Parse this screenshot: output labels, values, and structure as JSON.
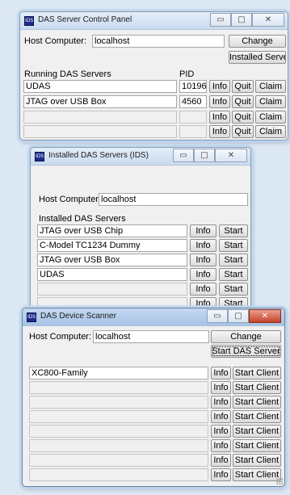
{
  "control_panel": {
    "title": "DAS Server Control Panel",
    "host_label": "Host Computer:",
    "host_value": "localhost",
    "change_label": "Change",
    "installed_servers_label": "Installed Servers",
    "running_header": "Running DAS Servers",
    "pid_header": "PID",
    "info_label": "Info",
    "quit_label": "Quit",
    "claim_label": "Claim",
    "rows": [
      {
        "name": "UDAS",
        "pid": "10196"
      },
      {
        "name": "JTAG over USB Box",
        "pid": "4560"
      },
      {
        "name": "",
        "pid": ""
      },
      {
        "name": "",
        "pid": ""
      }
    ]
  },
  "installed": {
    "title": "Installed DAS Servers (IDS)",
    "host_label": "Host Computer:",
    "host_value": "localhost",
    "list_header": "Installed DAS Servers",
    "info_label": "Info",
    "start_label": "Start",
    "rows": [
      {
        "name": "JTAG over USB Chip"
      },
      {
        "name": "C-Model TC1234 Dummy"
      },
      {
        "name": "JTAG over USB Box"
      },
      {
        "name": "UDAS"
      },
      {
        "name": ""
      },
      {
        "name": ""
      },
      {
        "name": ""
      },
      {
        "name": ""
      }
    ]
  },
  "scanner": {
    "title": "DAS Device Scanner",
    "host_label": "Host Computer:",
    "host_value": "localhost",
    "change_label": "Change",
    "start_server_label": "Start DAS Server",
    "info_label": "Info",
    "start_client_label": "Start Client",
    "rows": [
      {
        "name": "XC800-Family"
      },
      {
        "name": ""
      },
      {
        "name": ""
      },
      {
        "name": ""
      },
      {
        "name": ""
      },
      {
        "name": ""
      },
      {
        "name": ""
      },
      {
        "name": ""
      }
    ]
  },
  "window_controls": {
    "minimize": "▭",
    "maximize": "□",
    "close": "✕"
  },
  "app_icon_text": "IDS",
  "icons": [
    "app-icon",
    "minimize-icon",
    "maximize-icon",
    "close-icon"
  ]
}
